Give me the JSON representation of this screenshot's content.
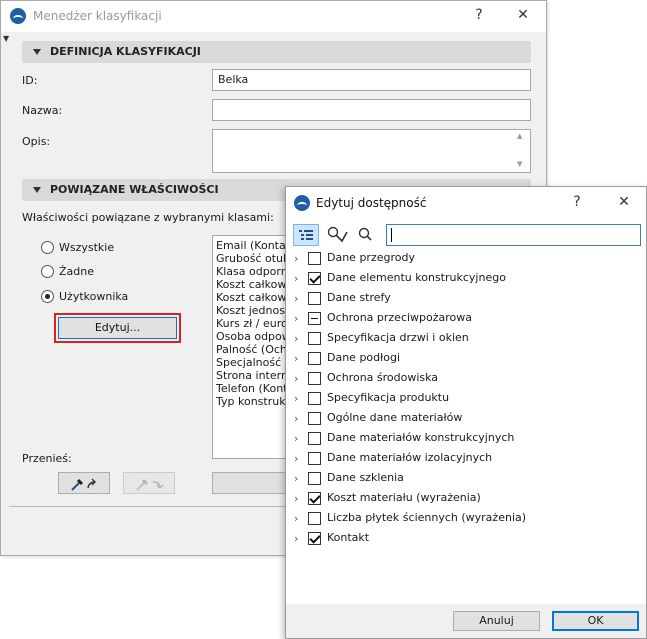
{
  "main_window": {
    "title": "Menedżer klasyfikacji",
    "help_glyph": "?",
    "close_glyph": "✕",
    "section1": {
      "title": "DEFINICJA KLASYFIKACJI"
    },
    "fields": {
      "id_label": "ID:",
      "id_value": "Belka",
      "name_label": "Nazwa:",
      "name_value": "",
      "desc_label": "Opis:",
      "desc_value": ""
    },
    "section2": {
      "title": "POWIĄZANE WŁAŚCIWOŚCI"
    },
    "linked_label": "Właściwości powiązane z wybranymi klasami:",
    "radios": [
      {
        "label": "Wszystkie",
        "checked": false
      },
      {
        "label": "Żadne",
        "checked": false
      },
      {
        "label": "Użytkownika",
        "checked": true
      }
    ],
    "edit_button": "Edytuj...",
    "properties": [
      "Email (Kontakt",
      "Grubość otuli",
      "Klasa odporn",
      "Koszt całkowi",
      "Koszt całkowi",
      "Koszt jednost",
      "Kurs zł / euro",
      "Osoba odpow",
      "Palność (Ochr",
      "Specjalność (K",
      "Strona intern",
      "Telefon (Konta",
      "Typ konstrukc"
    ],
    "move_label": "Przenieś:"
  },
  "dialog": {
    "title": "Edytuj dostępność",
    "help_glyph": "?",
    "close_glyph": "✕",
    "search_value": "",
    "items": [
      {
        "label": "Dane przegrody",
        "state": "unchecked"
      },
      {
        "label": "Dane elementu konstrukcyjnego",
        "state": "checked"
      },
      {
        "label": "Dane strefy",
        "state": "unchecked"
      },
      {
        "label": "Ochrona przeciwpożarowa",
        "state": "partial"
      },
      {
        "label": "Specyfikacja drzwi i okien",
        "state": "unchecked"
      },
      {
        "label": "Dane podłogi",
        "state": "unchecked"
      },
      {
        "label": "Ochrona środowiska",
        "state": "unchecked"
      },
      {
        "label": "Specyfikacja produktu",
        "state": "unchecked"
      },
      {
        "label": "Ogólne dane materiałów",
        "state": "unchecked"
      },
      {
        "label": "Dane materiałów konstrukcyjnych",
        "state": "unchecked"
      },
      {
        "label": "Dane materiałów izolacyjnych",
        "state": "unchecked"
      },
      {
        "label": "Dane szklenia",
        "state": "unchecked"
      },
      {
        "label": "Koszt materiału (wyrażenia)",
        "state": "checked"
      },
      {
        "label": "Liczba płytek ściennych (wyrażenia)",
        "state": "unchecked"
      },
      {
        "label": "Kontakt",
        "state": "checked"
      }
    ],
    "cancel_button": "Anuluj",
    "ok_button": "OK"
  }
}
